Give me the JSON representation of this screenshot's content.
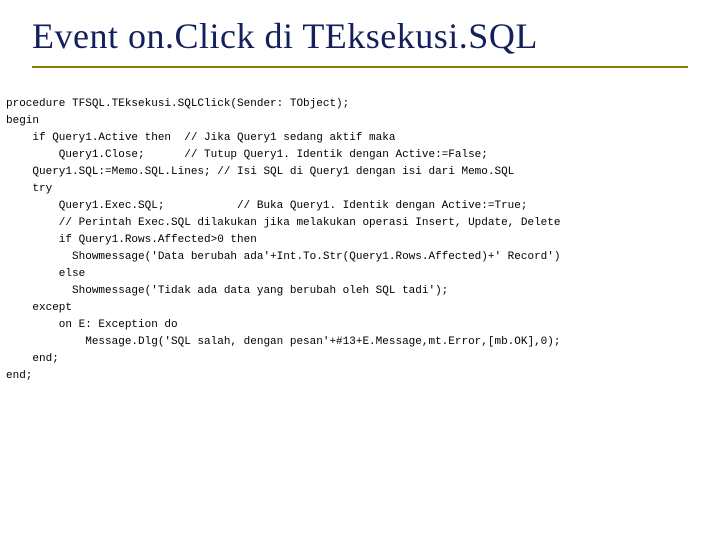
{
  "slide": {
    "title": "Event on.Click di TEksekusi.SQL",
    "code": "procedure TFSQL.TEksekusi.SQLClick(Sender: TObject);\nbegin\n    if Query1.Active then  // Jika Query1 sedang aktif maka\n        Query1.Close;      // Tutup Query1. Identik dengan Active:=False;\n    Query1.SQL:=Memo.SQL.Lines; // Isi SQL di Query1 dengan isi dari Memo.SQL\n    try\n        Query1.Exec.SQL;           // Buka Query1. Identik dengan Active:=True;\n        // Perintah Exec.SQL dilakukan jika melakukan operasi Insert, Update, Delete\n        if Query1.Rows.Affected>0 then\n          Showmessage('Data berubah ada'+Int.To.Str(Query1.Rows.Affected)+' Record')\n        else\n          Showmessage('Tidak ada data yang berubah oleh SQL tadi');\n    except\n        on E: Exception do\n            Message.Dlg('SQL salah, dengan pesan'+#13+E.Message,mt.Error,[mb.OK],0);\n    end;\nend;"
  }
}
